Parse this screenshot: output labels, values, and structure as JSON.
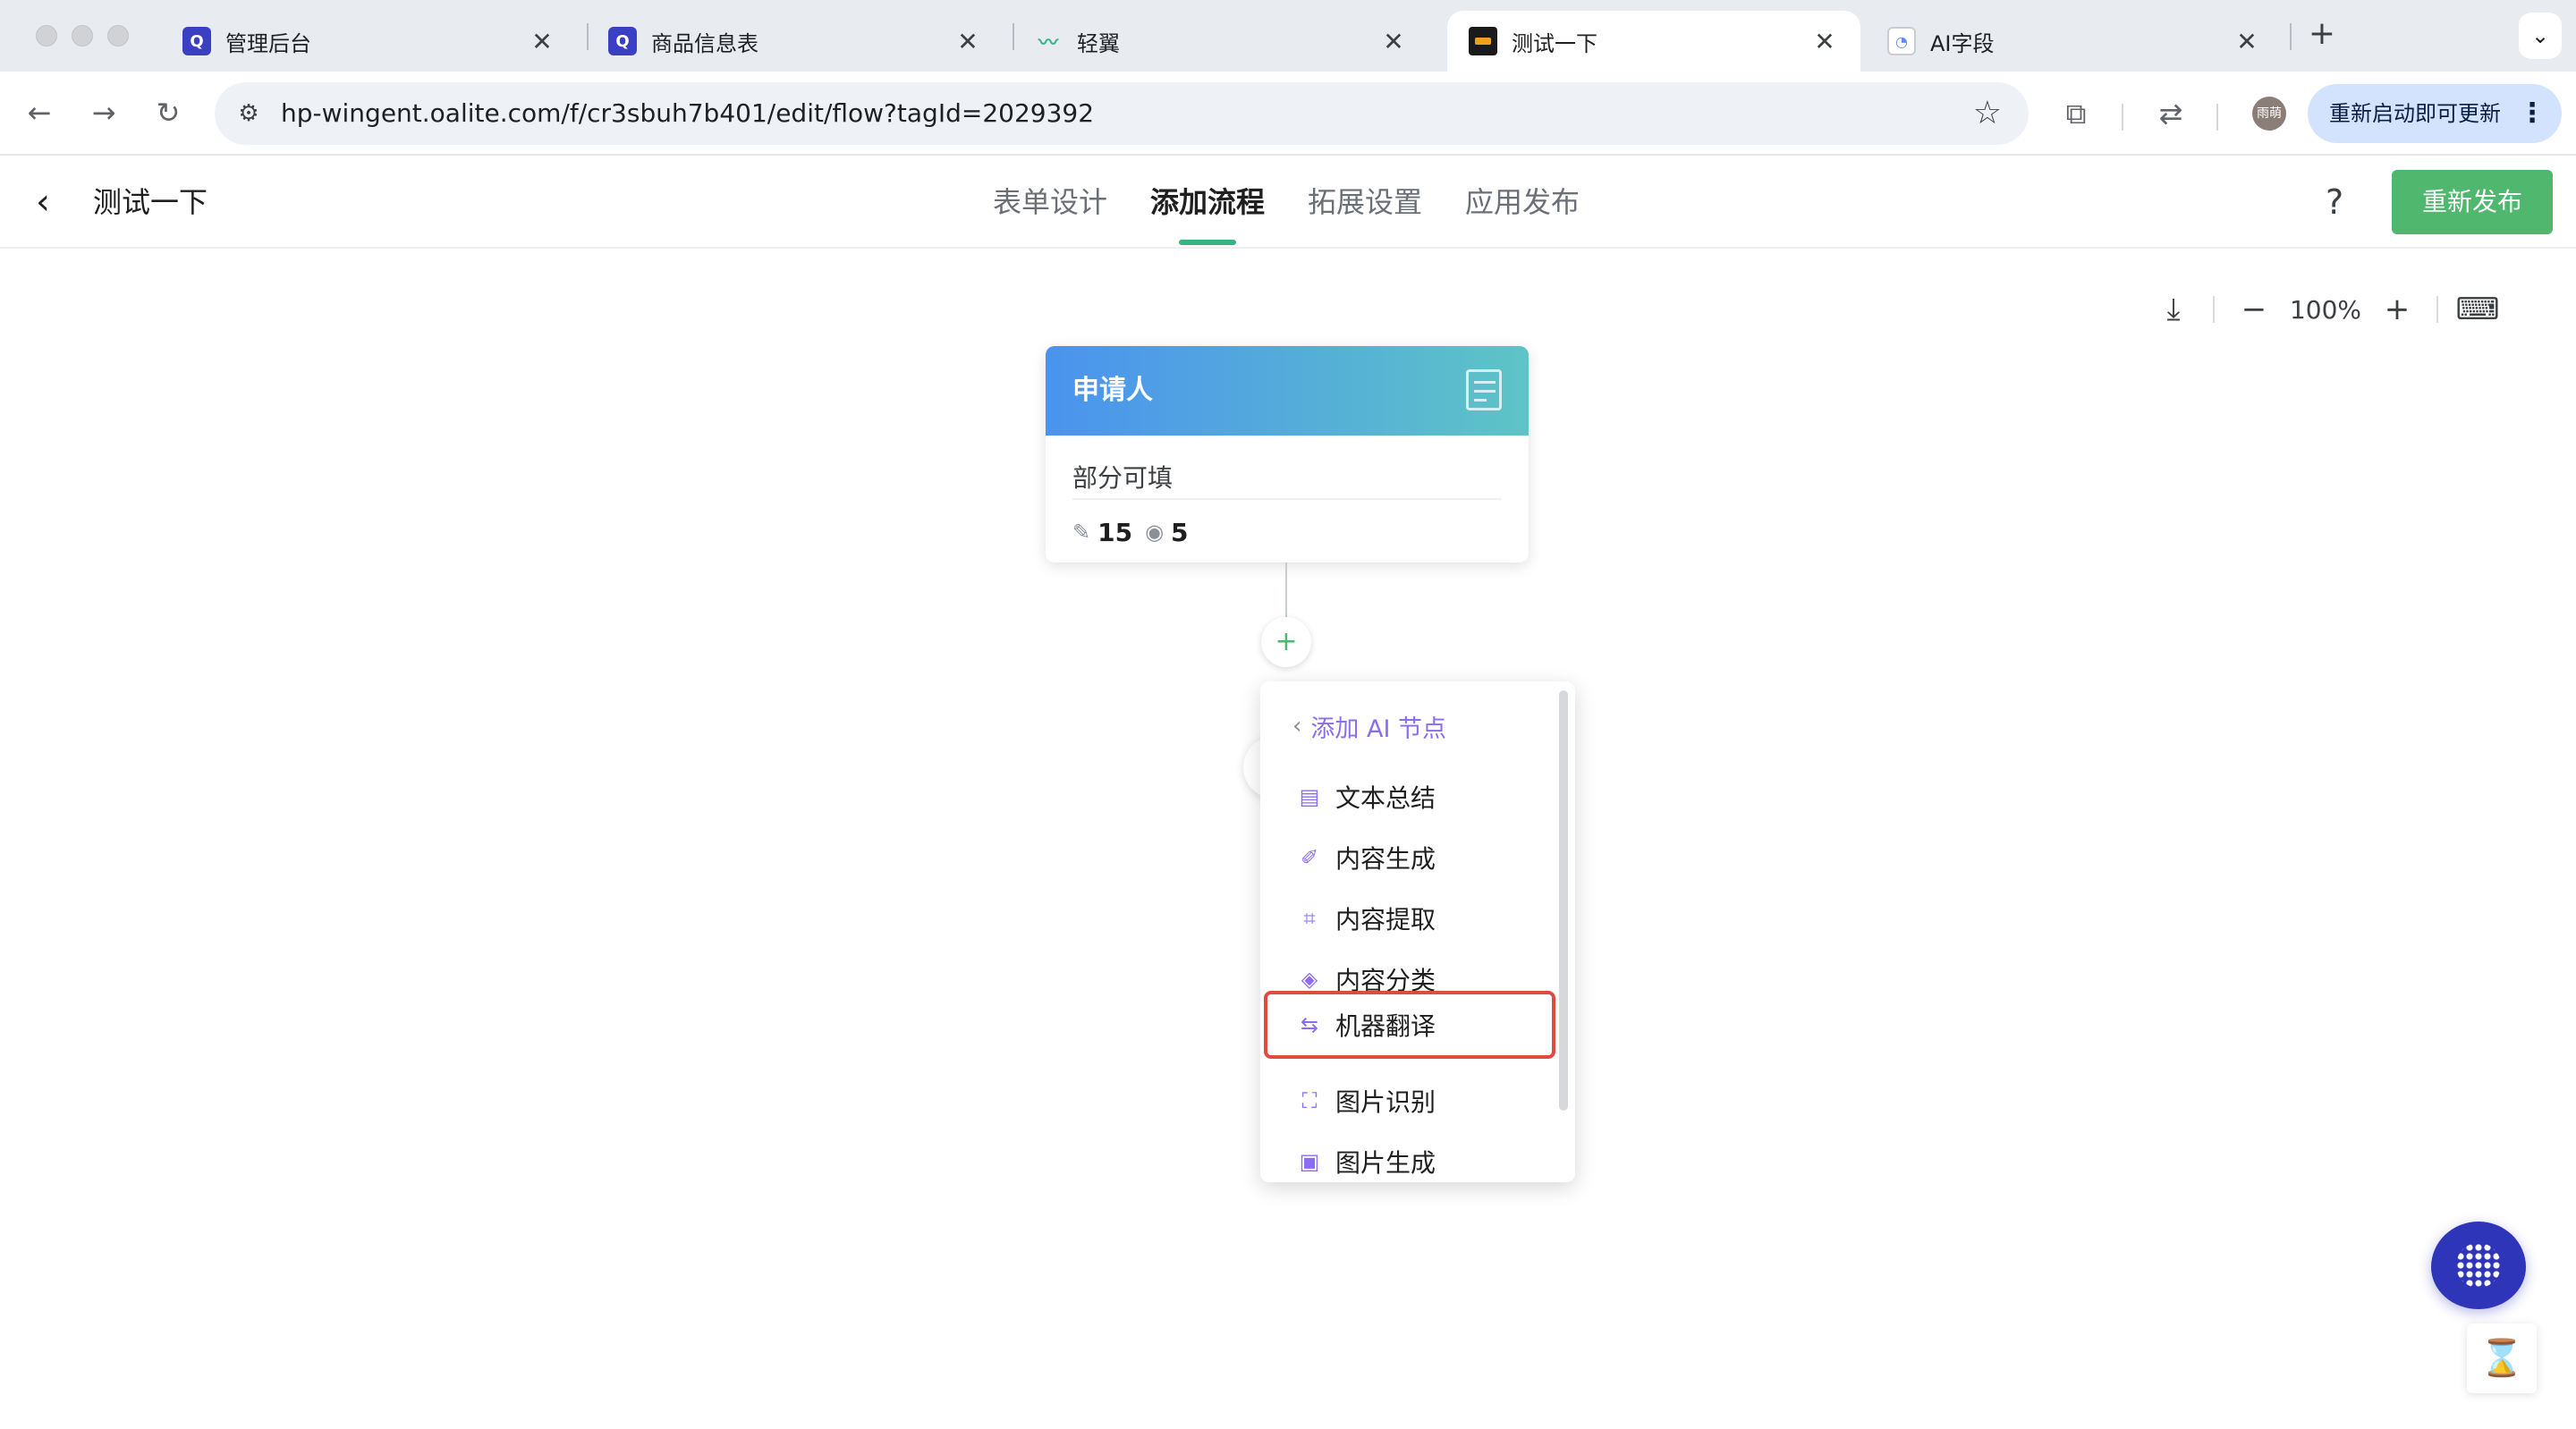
{
  "browser": {
    "tabs": [
      {
        "title": "管理后台",
        "favicon": "Q",
        "favicon_color": "#3a3fc4",
        "icon": "q-logo-icon"
      },
      {
        "title": "商品信息表",
        "favicon": "Q",
        "favicon_color": "#3a3fc4",
        "icon": "q-logo-icon"
      },
      {
        "title": "轻翼",
        "favicon": "",
        "favicon_color": "#ffffff",
        "icon": "wing-logo-icon"
      },
      {
        "title": "测试一下",
        "favicon": "",
        "favicon_color": "#1a1a1a",
        "icon": "app-logo-icon"
      },
      {
        "title": "AI字段",
        "favicon": "",
        "favicon_color": "#ffffff",
        "icon": "doc-logo-icon"
      }
    ],
    "active_tab_index": 3,
    "url": "hp-wingent.oalite.com/f/cr3sbuh7b401/edit/flow?tagId=2029392",
    "profile_label": "雨萌",
    "update_button": "重新启动即可更新"
  },
  "header": {
    "title": "测试一下",
    "tabs": [
      "表单设计",
      "添加流程",
      "拓展设置",
      "应用发布"
    ],
    "active_tab": "添加流程",
    "help": "?",
    "publish_button": "重新发布",
    "accent_color": "#4fb76e"
  },
  "canvas": {
    "zoom": "100%",
    "node": {
      "title": "申请人",
      "permission": "部分可填",
      "edit_count": "15",
      "view_count": "5"
    },
    "add_button": "+",
    "menu": {
      "back_label": "添加 AI 节点",
      "items": [
        {
          "label": "文本总结",
          "icon": "text-summary-icon"
        },
        {
          "label": "内容生成",
          "icon": "content-generate-icon"
        },
        {
          "label": "内容提取",
          "icon": "content-extract-icon"
        },
        {
          "label": "内容分类",
          "icon": "content-classify-icon"
        },
        {
          "label": "机器翻译",
          "icon": "machine-translate-icon"
        },
        {
          "label": "图片识别",
          "icon": "image-recognize-icon"
        },
        {
          "label": "图片生成",
          "icon": "image-generate-icon"
        }
      ],
      "highlighted_item": "机器翻译",
      "highlight_color": "#e04a3f"
    }
  }
}
